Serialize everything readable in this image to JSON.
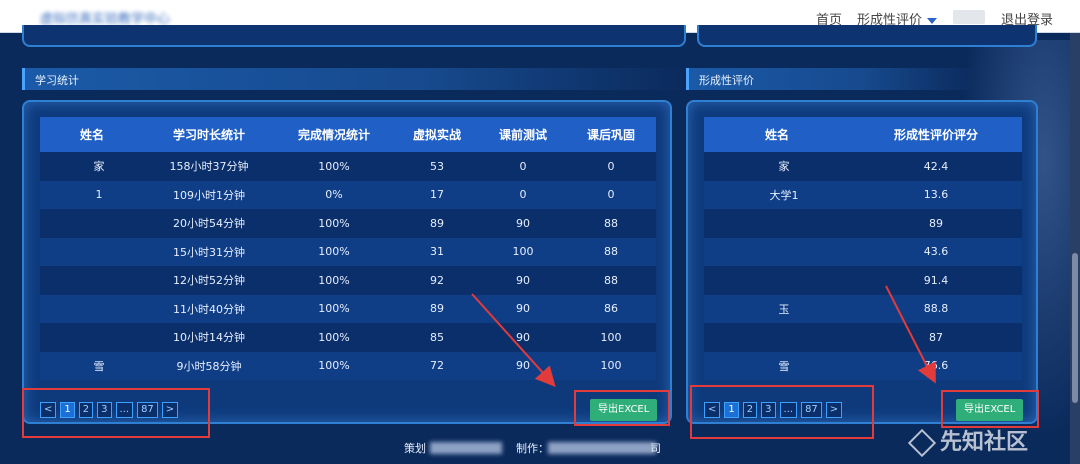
{
  "header": {
    "site_title": "虚拟仿真实验教学中心",
    "nav": {
      "home": "首页",
      "formative_eval": "形成性评价",
      "logout": "退出登录"
    }
  },
  "left_section": {
    "title": "学习统计",
    "columns": [
      "姓名",
      "学习时长统计",
      "完成情况统计",
      "虚拟实战",
      "课前测试",
      "课后巩固"
    ],
    "rows": [
      {
        "name": "家",
        "duration": "158小时37分钟",
        "completion": "100%",
        "virtual": "53",
        "pretest": "0",
        "posttest": "0"
      },
      {
        "name": "1",
        "duration": "109小时1分钟",
        "completion": "0%",
        "virtual": "17",
        "pretest": "0",
        "posttest": "0"
      },
      {
        "name": "",
        "duration": "20小时54分钟",
        "completion": "100%",
        "virtual": "89",
        "pretest": "90",
        "posttest": "88"
      },
      {
        "name": "",
        "duration": "15小时31分钟",
        "completion": "100%",
        "virtual": "31",
        "pretest": "100",
        "posttest": "88"
      },
      {
        "name": "",
        "duration": "12小时52分钟",
        "completion": "100%",
        "virtual": "92",
        "pretest": "90",
        "posttest": "88"
      },
      {
        "name": "",
        "duration": "11小时40分钟",
        "completion": "100%",
        "virtual": "89",
        "pretest": "90",
        "posttest": "86"
      },
      {
        "name": "",
        "duration": "10小时14分钟",
        "completion": "100%",
        "virtual": "85",
        "pretest": "90",
        "posttest": "100"
      },
      {
        "name": "雪",
        "duration": "9小时58分钟",
        "completion": "100%",
        "virtual": "72",
        "pretest": "90",
        "posttest": "100"
      }
    ],
    "pagination": [
      "<",
      "1",
      "2",
      "3",
      "...",
      "87",
      ">"
    ],
    "active_page": "1",
    "export_label": "导出EXCEL"
  },
  "right_section": {
    "title": "形成性评价",
    "columns": [
      "姓名",
      "形成性评价评分"
    ],
    "rows": [
      {
        "name": "家",
        "score": "42.4"
      },
      {
        "name": "大学1",
        "score": "13.6"
      },
      {
        "name": "",
        "score": "89"
      },
      {
        "name": "",
        "score": "43.6"
      },
      {
        "name": "",
        "score": "91.4"
      },
      {
        "name": "玉",
        "score": "88.8"
      },
      {
        "name": "",
        "score": "87"
      },
      {
        "name": "雪",
        "score": "76.6"
      }
    ],
    "pagination": [
      "<",
      "1",
      "2",
      "3",
      "...",
      "87",
      ">"
    ],
    "active_page": "1",
    "export_label": "导出EXCEL"
  },
  "footer": {
    "planner_label": "策划",
    "maker_label": "制作：",
    "maker_end": "司"
  },
  "watermark": "先知社区",
  "colors": {
    "background": "#0b2a5c",
    "header_cell": "#1f5fc6",
    "export_button": "#2fae7a",
    "annotation_red": "#e23b3b"
  }
}
